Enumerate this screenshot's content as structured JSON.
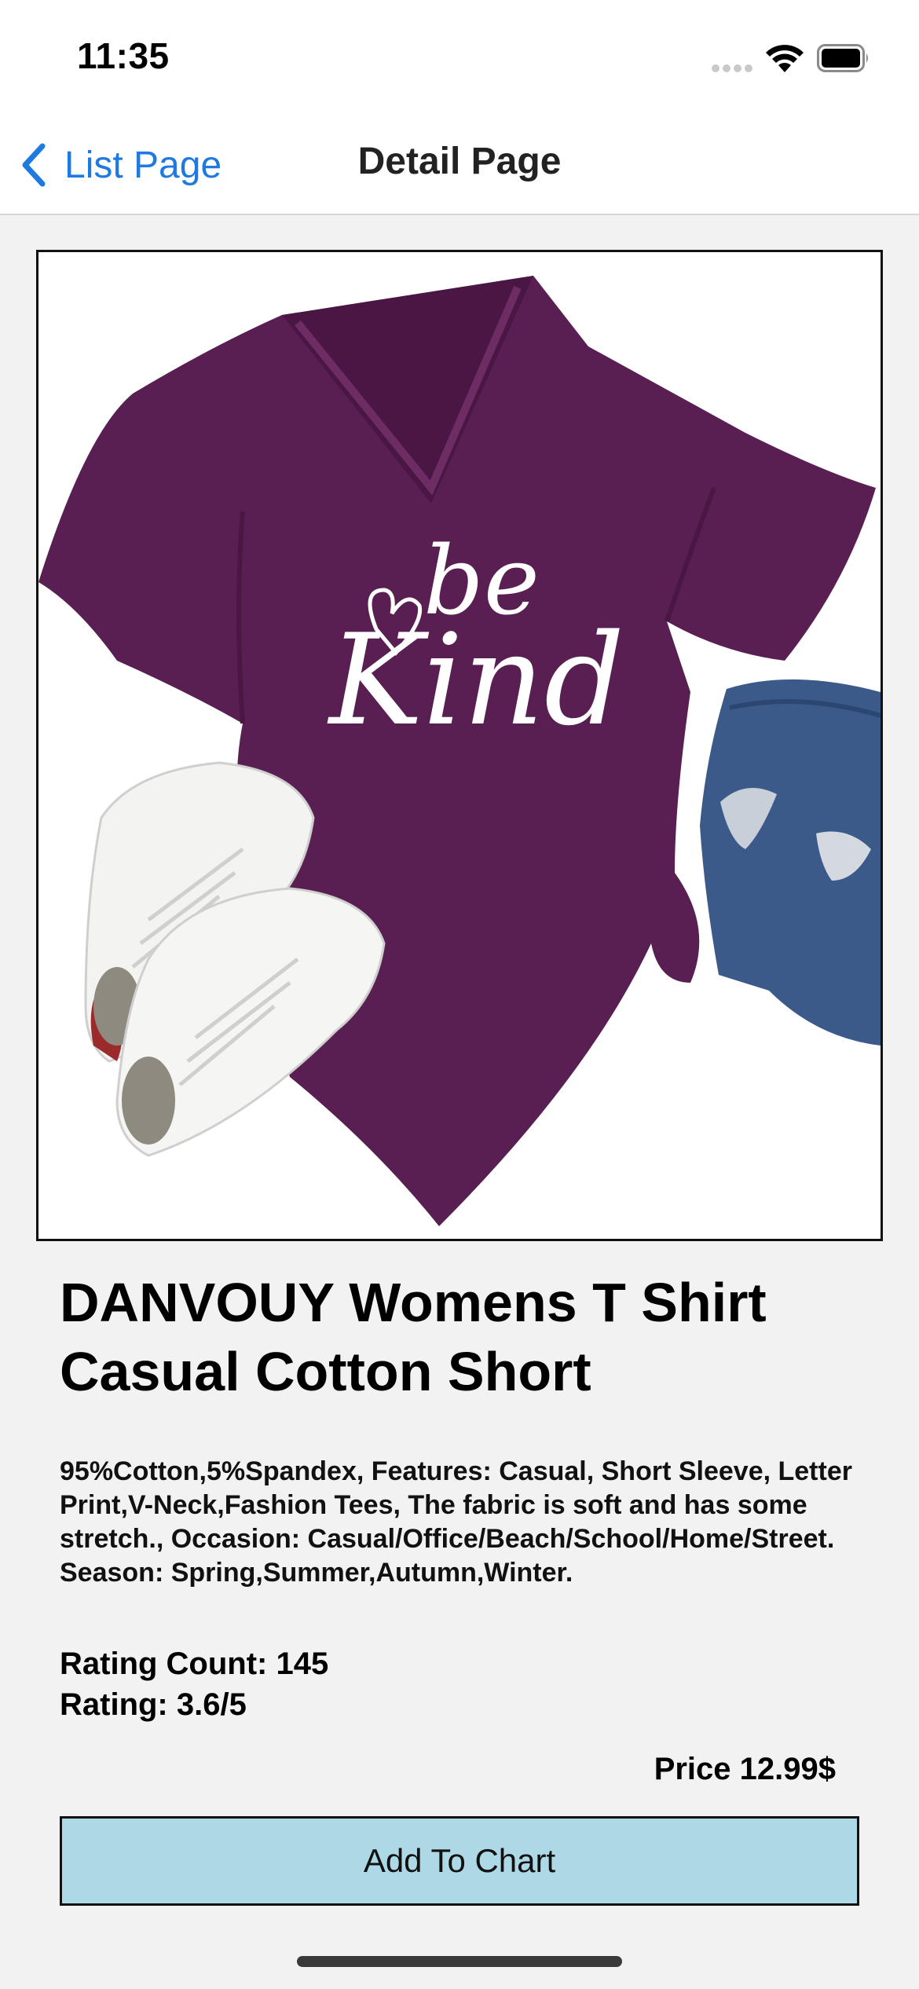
{
  "status_bar": {
    "time": "11:35"
  },
  "nav": {
    "back_label": "List Page",
    "title": "Detail Page"
  },
  "product": {
    "image_alt": "be kind",
    "image_text_line1": "be",
    "image_text_line2": "Kind",
    "title": "DANVOUY Womens T Shirt Casual Cotton Short",
    "description": "95%Cotton,5%Spandex, Features: Casual, Short Sleeve, Letter Print,V-Neck,Fashion Tees, The fabric is soft and has some stretch., Occasion: Casual/Office/Beach/School/Home/Street. Season: Spring,Summer,Autumn,Winter.",
    "rating_count_text": "Rating Count: 145",
    "rating_text": "Rating: 3.6/5",
    "price_text": "Price 12.99$",
    "add_button_label": "Add To Chart"
  },
  "colors": {
    "accent": "#1f7ae0",
    "button_bg": "#add8e6",
    "shirt": "#5a1f52",
    "background": "#f2f2f2"
  },
  "icons": {
    "back": "chevron-left-icon",
    "wifi": "wifi-icon",
    "battery": "battery-icon",
    "signal": "cellular-signal-icon"
  }
}
